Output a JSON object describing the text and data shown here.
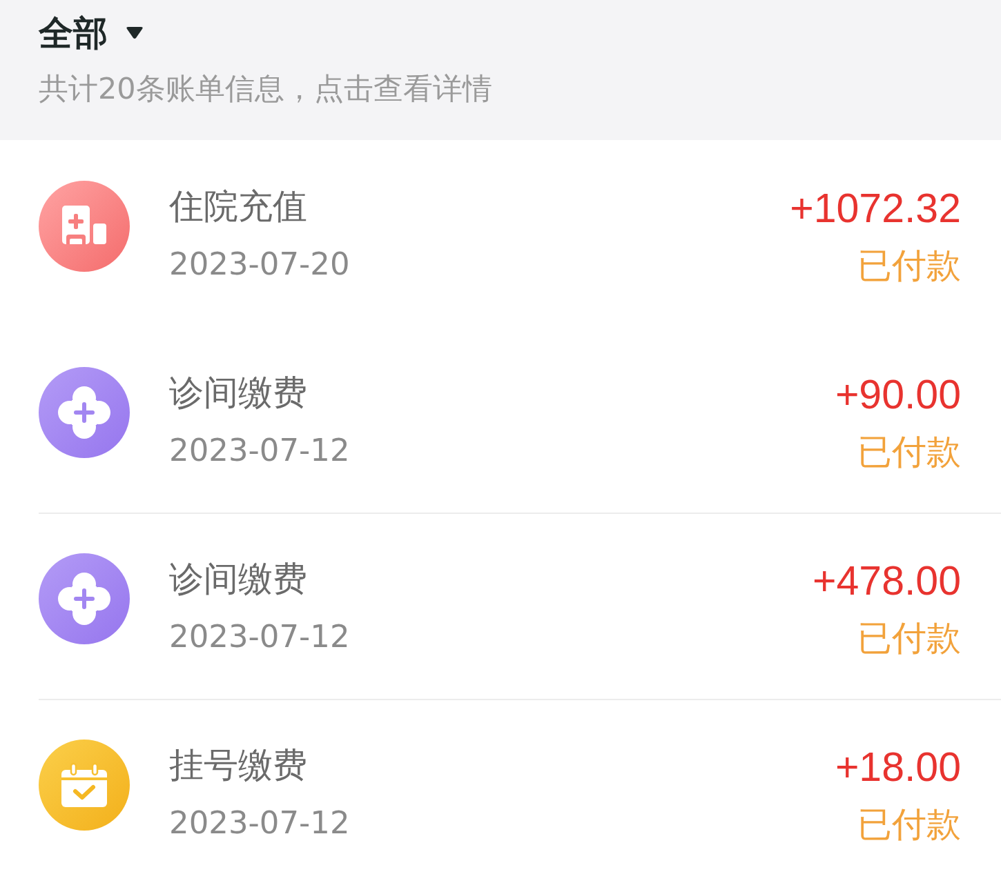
{
  "filter": {
    "label": "全部"
  },
  "summary": "共计20条账单信息，点击查看详情",
  "bills": [
    {
      "kind": "hospital",
      "title": "住院充值",
      "date": "2023-07-20",
      "amount": "+1072.32",
      "status": "已付款",
      "divider_above": false
    },
    {
      "kind": "clinic",
      "title": "诊间缴费",
      "date": "2023-07-12",
      "amount": "+90.00",
      "status": "已付款",
      "divider_above": false
    },
    {
      "kind": "clinic",
      "title": "诊间缴费",
      "date": "2023-07-12",
      "amount": "+478.00",
      "status": "已付款",
      "divider_above": true
    },
    {
      "kind": "registration",
      "title": "挂号缴费",
      "date": "2023-07-12",
      "amount": "+18.00",
      "status": "已付款",
      "divider_above": true
    }
  ]
}
